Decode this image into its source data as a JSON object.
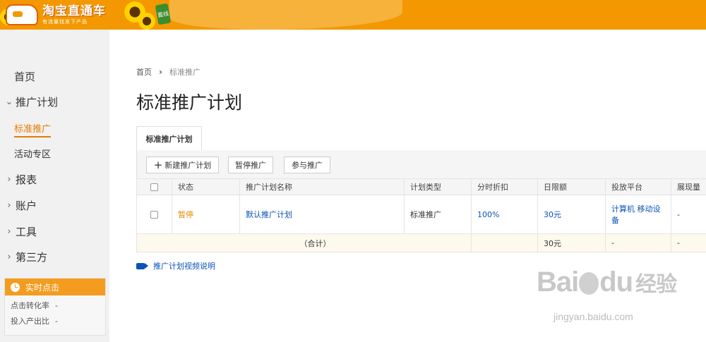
{
  "header": {
    "logo_title": "淘宝直通车",
    "logo_subtitle": "有流量找准下产品",
    "badge": "直线"
  },
  "sidebar": {
    "home": "首页",
    "promotion_plan": "推广计划",
    "standard_promotion": "标准推广",
    "activity_zone": "活动专区",
    "reports": "报表",
    "account": "账户",
    "tools": "工具",
    "third_party": "第三方"
  },
  "realtime": {
    "title": "实时点击",
    "ctr_label": "点击转化率",
    "ctr_value": "-",
    "roi_label": "投入产出比",
    "roi_value": "-"
  },
  "breadcrumb": {
    "home": "首页",
    "current": "标准推广"
  },
  "page_title": "标准推广计划",
  "tab_label": "标准推广计划",
  "toolbar": {
    "new_plan": "新建推广计划",
    "pause": "暂停推广",
    "join": "参与推广"
  },
  "table": {
    "headers": [
      "状态",
      "推广计划名称",
      "计划类型",
      "分时折扣",
      "日限额",
      "投放平台",
      "展现量"
    ],
    "row": {
      "status": "暂停",
      "name": "默认推广计划",
      "type": "标准推广",
      "discount": "100%",
      "daily_limit": "30元",
      "platform": "计算机 移动设备",
      "impressions": "-"
    },
    "total": {
      "label": "（合计）",
      "daily_limit": "30元",
      "platform": "-",
      "impressions": "-"
    }
  },
  "video_link": "推广计划视频说明",
  "watermark": {
    "text_a": "Bai",
    "text_b": "du",
    "text_cn": "经验",
    "url": "jingyan.baidu.com"
  }
}
